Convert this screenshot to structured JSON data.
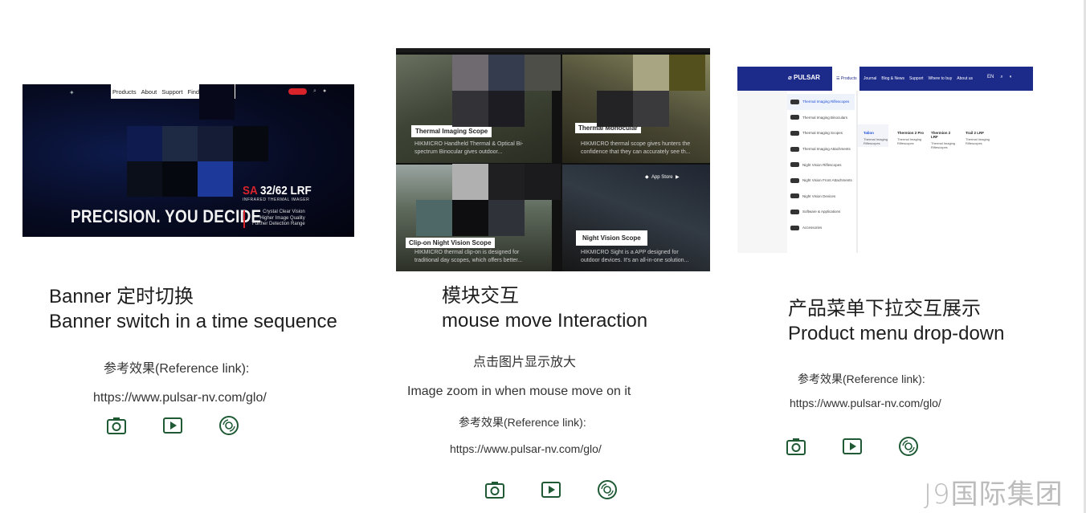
{
  "sections": [
    {
      "id": "banner",
      "title_cn": "Banner 定时切换",
      "title_en": "Banner switch in a time sequence",
      "ref_label": "参考效果(Reference link):",
      "ref_url": "https://www.pulsar-nv.com/glo/"
    },
    {
      "id": "module",
      "title_cn": "模块交互",
      "title_en": "mouse move Interaction",
      "desc_cn": "点击图片显示放大",
      "desc_en": "Image zoom in when mouse move on it",
      "ref_label": "参考效果(Reference link):",
      "ref_url": "https://www.pulsar-nv.com/glo/"
    },
    {
      "id": "menu",
      "title_cn": "产品菜单下拉交互展示",
      "title_en": "Product menu drop-down",
      "ref_label": "参考效果(Reference link):",
      "ref_url": "https://www.pulsar-nv.com/glo/"
    }
  ],
  "icons": [
    "camera-icon",
    "play-icon",
    "disc-icon"
  ],
  "icon_color": "#1f5a35",
  "shot1": {
    "nav": [
      "Products",
      "About",
      "Support",
      "Find"
    ],
    "headline": "PRECISION. YOU DECIDE",
    "product_prefix": "SA",
    "product_name": "32/62 LRF",
    "product_sub": "INFRARED THERMAL IMAGER",
    "bullets": [
      "Crystal Clear Vision",
      "Higher Image Quality",
      "Further Detection Range"
    ]
  },
  "shot2": {
    "tiles": [
      {
        "label": "Thermal Imaging Scope",
        "desc": [
          "HIKMICRO Handheld Thermal & Optical Bi-",
          "spectrum Binocular gives outdoor..."
        ]
      },
      {
        "label": "Thermal Monocular",
        "desc": [
          "HIKMICRO thermal scope gives hunters the",
          "confidence that they can accurately see th..."
        ]
      },
      {
        "label": "Clip-on Night Vision Scope",
        "desc": [
          "HIKMICRO thermal clip-on is designed for",
          "traditional day scopes, which offers better..."
        ]
      },
      {
        "label": "Night Vision Scope",
        "desc": [
          "HIKMICRO Sight is a APP designed for",
          "outdoor devices. It's an all-in-one solution..."
        ]
      }
    ],
    "store_badges": "App Store"
  },
  "shot3": {
    "brand": "PULSAR",
    "active_tab": "Products",
    "nav": [
      "Journal",
      "Blog & News",
      "Support",
      "Where to buy",
      "About us"
    ],
    "lang": "EN",
    "menu": [
      "Thermal Imaging Riflescopes",
      "Thermal Imaging Binoculars",
      "Thermal Imaging Scopes",
      "Thermal Imaging Attachments",
      "Night Vision Riflescopes",
      "Night Vision Front Attachments",
      "Night Vision Devices",
      "Software & Applications",
      "Accessories"
    ],
    "submenu": [
      {
        "title": "Talion",
        "desc": "Thermal Imaging Riflescopes"
      },
      {
        "title": "Thermion 2 Pro",
        "desc": "Thermal Imaging Riflescopes"
      },
      {
        "title": "Thermion 2 LRF",
        "desc": "Thermal Imaging Riflescopes"
      },
      {
        "title": "Trail 2 LRF",
        "desc": "Thermal Imaging Riflescopes"
      }
    ]
  },
  "watermark": "J9国际集团"
}
